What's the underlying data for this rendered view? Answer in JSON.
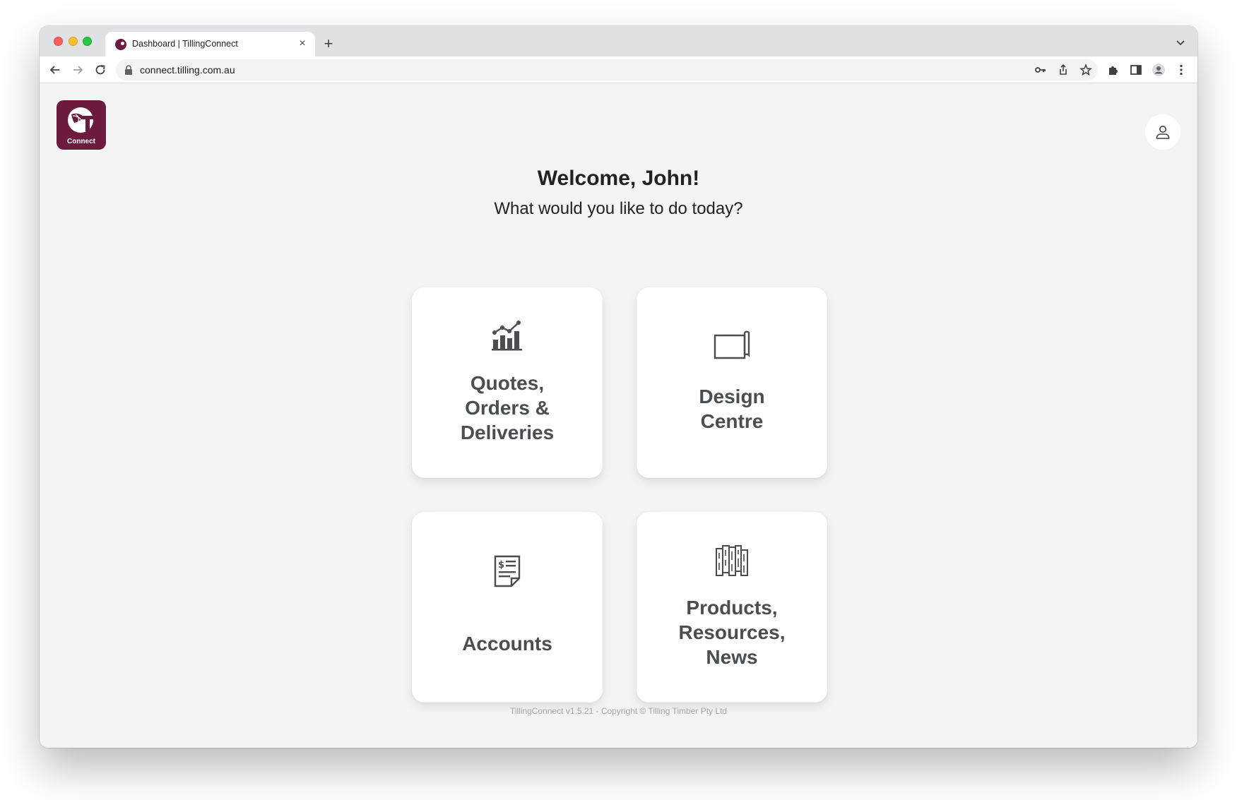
{
  "browser": {
    "tab_title": "Dashboard | TillingConnect",
    "url": "connect.tilling.com.au"
  },
  "app": {
    "logo_text": "Connect",
    "brand_color": "#6d1a3f"
  },
  "header": {
    "welcome": "Welcome, John!",
    "subtitle": "What would you like to do today?"
  },
  "cards": [
    {
      "label": "Quotes,\nOrders &\nDeliveries",
      "icon": "chart-icon"
    },
    {
      "label": "Design\nCentre",
      "icon": "blueprint-icon"
    },
    {
      "label": "Accounts",
      "icon": "invoice-icon"
    },
    {
      "label": "Products,\nResources,\nNews",
      "icon": "timber-icon"
    }
  ],
  "footer": {
    "text": "TillingConnect v1.5.21 - Copyright © Tilling Timber Pty Ltd"
  }
}
